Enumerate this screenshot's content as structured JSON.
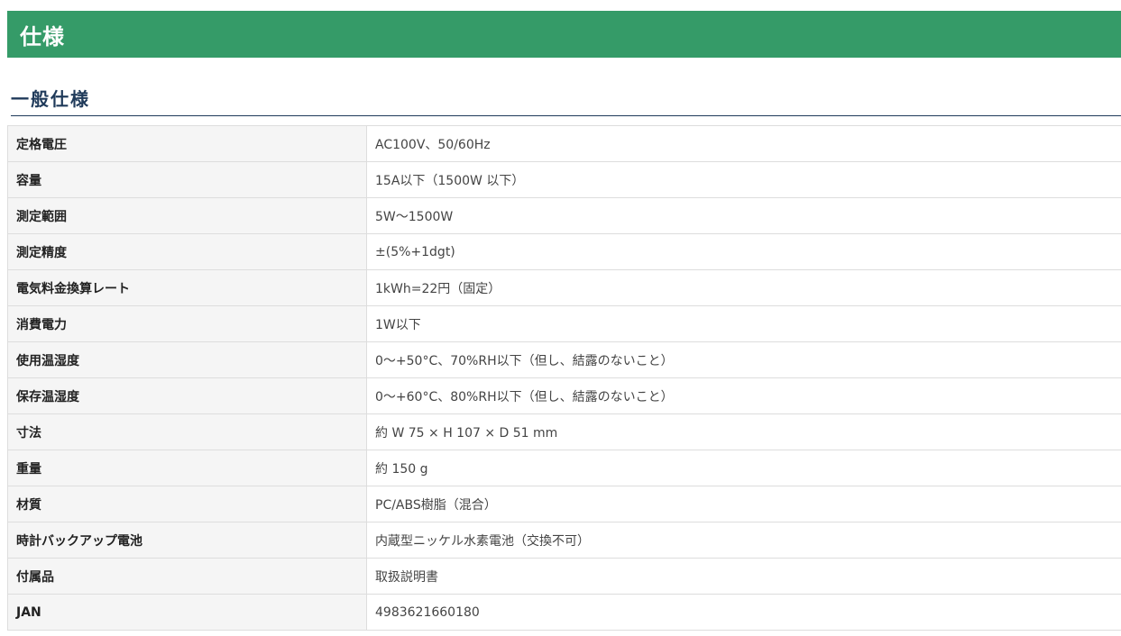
{
  "page_title": "仕様",
  "section_title": "一般仕様",
  "specs": [
    {
      "label": "定格電圧",
      "value": "AC100V、50/60Hz"
    },
    {
      "label": "容量",
      "value": "15A以下（1500W 以下）"
    },
    {
      "label": "測定範囲",
      "value": "5W～1500W"
    },
    {
      "label": "測定精度",
      "value": "±(5%+1dgt)"
    },
    {
      "label": "電気料金換算レート",
      "value": "1kWh=22円（固定）"
    },
    {
      "label": "消費電力",
      "value": "1W以下"
    },
    {
      "label": "使用温湿度",
      "value": "0～+50°C、70%RH以下（但し、結露のないこと）"
    },
    {
      "label": "保存温湿度",
      "value": "0～+60°C、80%RH以下（但し、結露のないこと）"
    },
    {
      "label": "寸法",
      "value": "約 W 75 × H 107 × D 51 mm"
    },
    {
      "label": "重量",
      "value": "約 150 g"
    },
    {
      "label": "材質",
      "value": "PC/ABS樹脂（混合）"
    },
    {
      "label": "時計バックアップ電池",
      "value": "内蔵型ニッケル水素電池（交換不可）"
    },
    {
      "label": "付属品",
      "value": "取扱説明書"
    },
    {
      "label": "JAN",
      "value": "4983621660180"
    }
  ],
  "colors": {
    "header_bg": "#359b68",
    "subheading_text": "#1f3a5a",
    "label_bg": "#f5f5f5",
    "border": "#dddddd"
  }
}
